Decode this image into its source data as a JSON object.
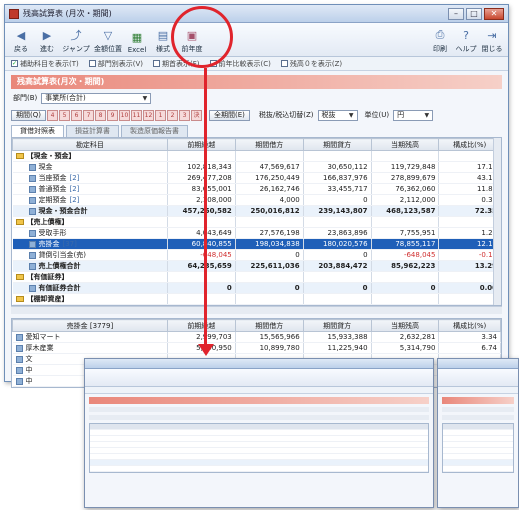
{
  "window": {
    "title": "残高試算表 (月次・期間)"
  },
  "toolbar": {
    "buttons": [
      {
        "label": "戻る",
        "icon": "back-arrow-icon"
      },
      {
        "label": "進む",
        "icon": "forward-arrow-icon"
      },
      {
        "label": "ジャンプ",
        "icon": "jump-icon"
      },
      {
        "label": "金額位置",
        "icon": "filter-icon"
      },
      {
        "label": "Excel",
        "icon": "excel-icon"
      },
      {
        "label": "様式",
        "icon": "format-icon"
      },
      {
        "label": "前年度",
        "icon": "previous-year-icon"
      }
    ],
    "right_buttons": [
      {
        "label": "印刷",
        "icon": "print-icon"
      },
      {
        "label": "ヘルプ",
        "icon": "help-icon"
      },
      {
        "label": "閉じる",
        "icon": "close-door-icon"
      }
    ]
  },
  "options": [
    "補助科目を表示(T)",
    "部門別表示(V)",
    "期首表示(F)",
    "前年比較表示(C)",
    "残高０を表示(Z)"
  ],
  "report": {
    "banner": "残高試算表(月次・期間)",
    "dept_label": "部門(B)",
    "dept_value": "事業所(合計)",
    "period_label": "期間(Q)",
    "months": [
      "4",
      "5",
      "6",
      "7",
      "8",
      "9",
      "10",
      "11",
      "12",
      "1",
      "2",
      "3",
      "決"
    ],
    "all_period_button": "全期間(E)",
    "tax_label": "税抜/税込切替(Z)",
    "tax_value": "税抜",
    "unit_label": "単位(U)",
    "unit_value": "円",
    "tabs": [
      "貸借対照表",
      "損益計算書",
      "製造原価報告書"
    ],
    "columns": [
      "勘定科目",
      "前期繰越",
      "期間借方",
      "期間貸方",
      "当期残高",
      "構成比(%)"
    ],
    "rows": [
      {
        "kind": "sect",
        "name": "【現金・預金】",
        "c1": "",
        "c2": "",
        "c3": "",
        "c4": "",
        "c5": ""
      },
      {
        "kind": "item",
        "name": "現金",
        "c1": "102,818,343",
        "c2": "47,569,617",
        "c3": "30,650,112",
        "c4": "119,729,848",
        "c5": "17.11"
      },
      {
        "kind": "item",
        "name": "当座預金",
        "badge": "[2]",
        "c1": "269,477,208",
        "c2": "176,250,449",
        "c3": "166,837,976",
        "c4": "278,899,679",
        "c5": "43.11"
      },
      {
        "kind": "item",
        "name": "普通預金",
        "badge": "[2]",
        "c1": "83,655,001",
        "c2": "26,162,746",
        "c3": "33,455,717",
        "c4": "76,362,060",
        "c5": "11.81"
      },
      {
        "kind": "item",
        "name": "定期預金",
        "badge": "[2]",
        "c1": "2,108,000",
        "c2": "4,000",
        "c3": "0",
        "c4": "2,112,000",
        "c5": "0.33"
      },
      {
        "kind": "sub",
        "name": "現金・預金合計",
        "c1": "457,250,582",
        "c2": "250,016,812",
        "c3": "239,143,807",
        "c4": "468,123,587",
        "c5": "72.35"
      },
      {
        "kind": "sect",
        "name": "【売上債権】",
        "c1": "",
        "c2": "",
        "c3": "",
        "c4": "",
        "c5": ""
      },
      {
        "kind": "item",
        "name": "受取手形",
        "c1": "4,043,649",
        "c2": "27,576,198",
        "c3": "23,863,896",
        "c4": "7,755,951",
        "c5": "1.20"
      },
      {
        "kind": "sel",
        "name": "売掛金",
        "badge": "[37]",
        "c1": "60,840,855",
        "c2": "198,034,838",
        "c3": "180,020,576",
        "c4": "78,855,117",
        "c5": "12.19"
      },
      {
        "kind": "item",
        "name": "貸倒引当金(売)",
        "c1": "-648,045",
        "c2": "0",
        "c3": "0",
        "c4": "-648,045",
        "c5": "-0.10",
        "neg": true
      },
      {
        "kind": "sub",
        "name": "売上債権合計",
        "c1": "64,235,659",
        "c2": "225,611,036",
        "c3": "203,884,472",
        "c4": "85,962,223",
        "c5": "13.29"
      },
      {
        "kind": "sect",
        "name": "【有価証券】",
        "c1": "",
        "c2": "",
        "c3": "",
        "c4": "",
        "c5": ""
      },
      {
        "kind": "sub",
        "name": "有価証券合計",
        "c1": "0",
        "c2": "0",
        "c3": "0",
        "c4": "0",
        "c5": "0.00"
      },
      {
        "kind": "sect",
        "name": "【棚卸資産】",
        "c1": "",
        "c2": "",
        "c3": "",
        "c4": "",
        "c5": ""
      }
    ],
    "sub_columns": [
      "売掛金 [3779]",
      "前期繰越",
      "期間借方",
      "期間貸方",
      "当期残高",
      "構成比(%)"
    ],
    "sub_rows": [
      {
        "name": "愛知マート",
        "c1": "2,999,703",
        "c2": "15,565,966",
        "c3": "15,933,388",
        "c4": "2,632,281",
        "c5": "3.34"
      },
      {
        "name": "厚木産業",
        "c1": "5,650,950",
        "c2": "10,899,780",
        "c3": "11,225,940",
        "c4": "5,314,790",
        "c5": "6.74"
      },
      {
        "name": "文",
        "c1": "",
        "c2": "",
        "c3": "",
        "c4": "",
        "c5": ""
      },
      {
        "name": "中",
        "c1": "",
        "c2": "",
        "c3": "",
        "c4": "",
        "c5": ""
      },
      {
        "name": "中",
        "c1": "",
        "c2": "",
        "c3": "",
        "c4": "",
        "c5": ""
      }
    ]
  },
  "colors": {
    "highlight": "#e0242c",
    "banner": "#e9877a",
    "selection": "#1f5fb8"
  }
}
